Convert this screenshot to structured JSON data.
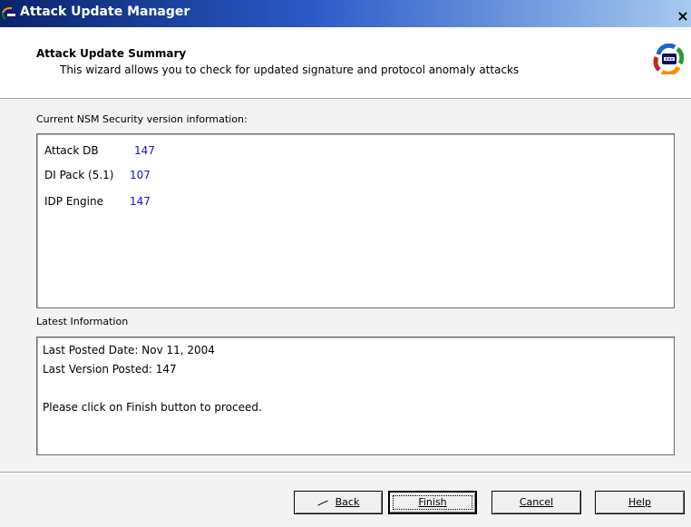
{
  "window": {
    "title": "Attack Update Manager",
    "close_label": "×",
    "icon": "app-icon"
  },
  "header": {
    "title": "Attack Update Summary",
    "subtitle": "This wizard allows you to check for updated signature and protocol anomaly attacks",
    "icon": "wizard-update-icon"
  },
  "current": {
    "label": "Current NSM Security version information:",
    "rows": [
      {
        "name": "Attack DB",
        "value": "147"
      },
      {
        "name": "DI Pack (5.1)",
        "value": "107"
      },
      {
        "name": "IDP Engine",
        "value": "147"
      }
    ]
  },
  "latest": {
    "label": "Latest Information",
    "lines": [
      "Last Posted Date: Nov 11, 2004",
      "Last Version Posted: 147",
      "",
      "Please click on Finish button to proceed."
    ]
  },
  "buttons": {
    "back": "Back",
    "finish": "Finish",
    "cancel": "Cancel",
    "help": "Help"
  },
  "colors": {
    "titlebar_start": "#0a246a",
    "titlebar_end": "#a6caf0",
    "version_value": "#1414c8",
    "panel_bg": "#f3f3f3"
  }
}
